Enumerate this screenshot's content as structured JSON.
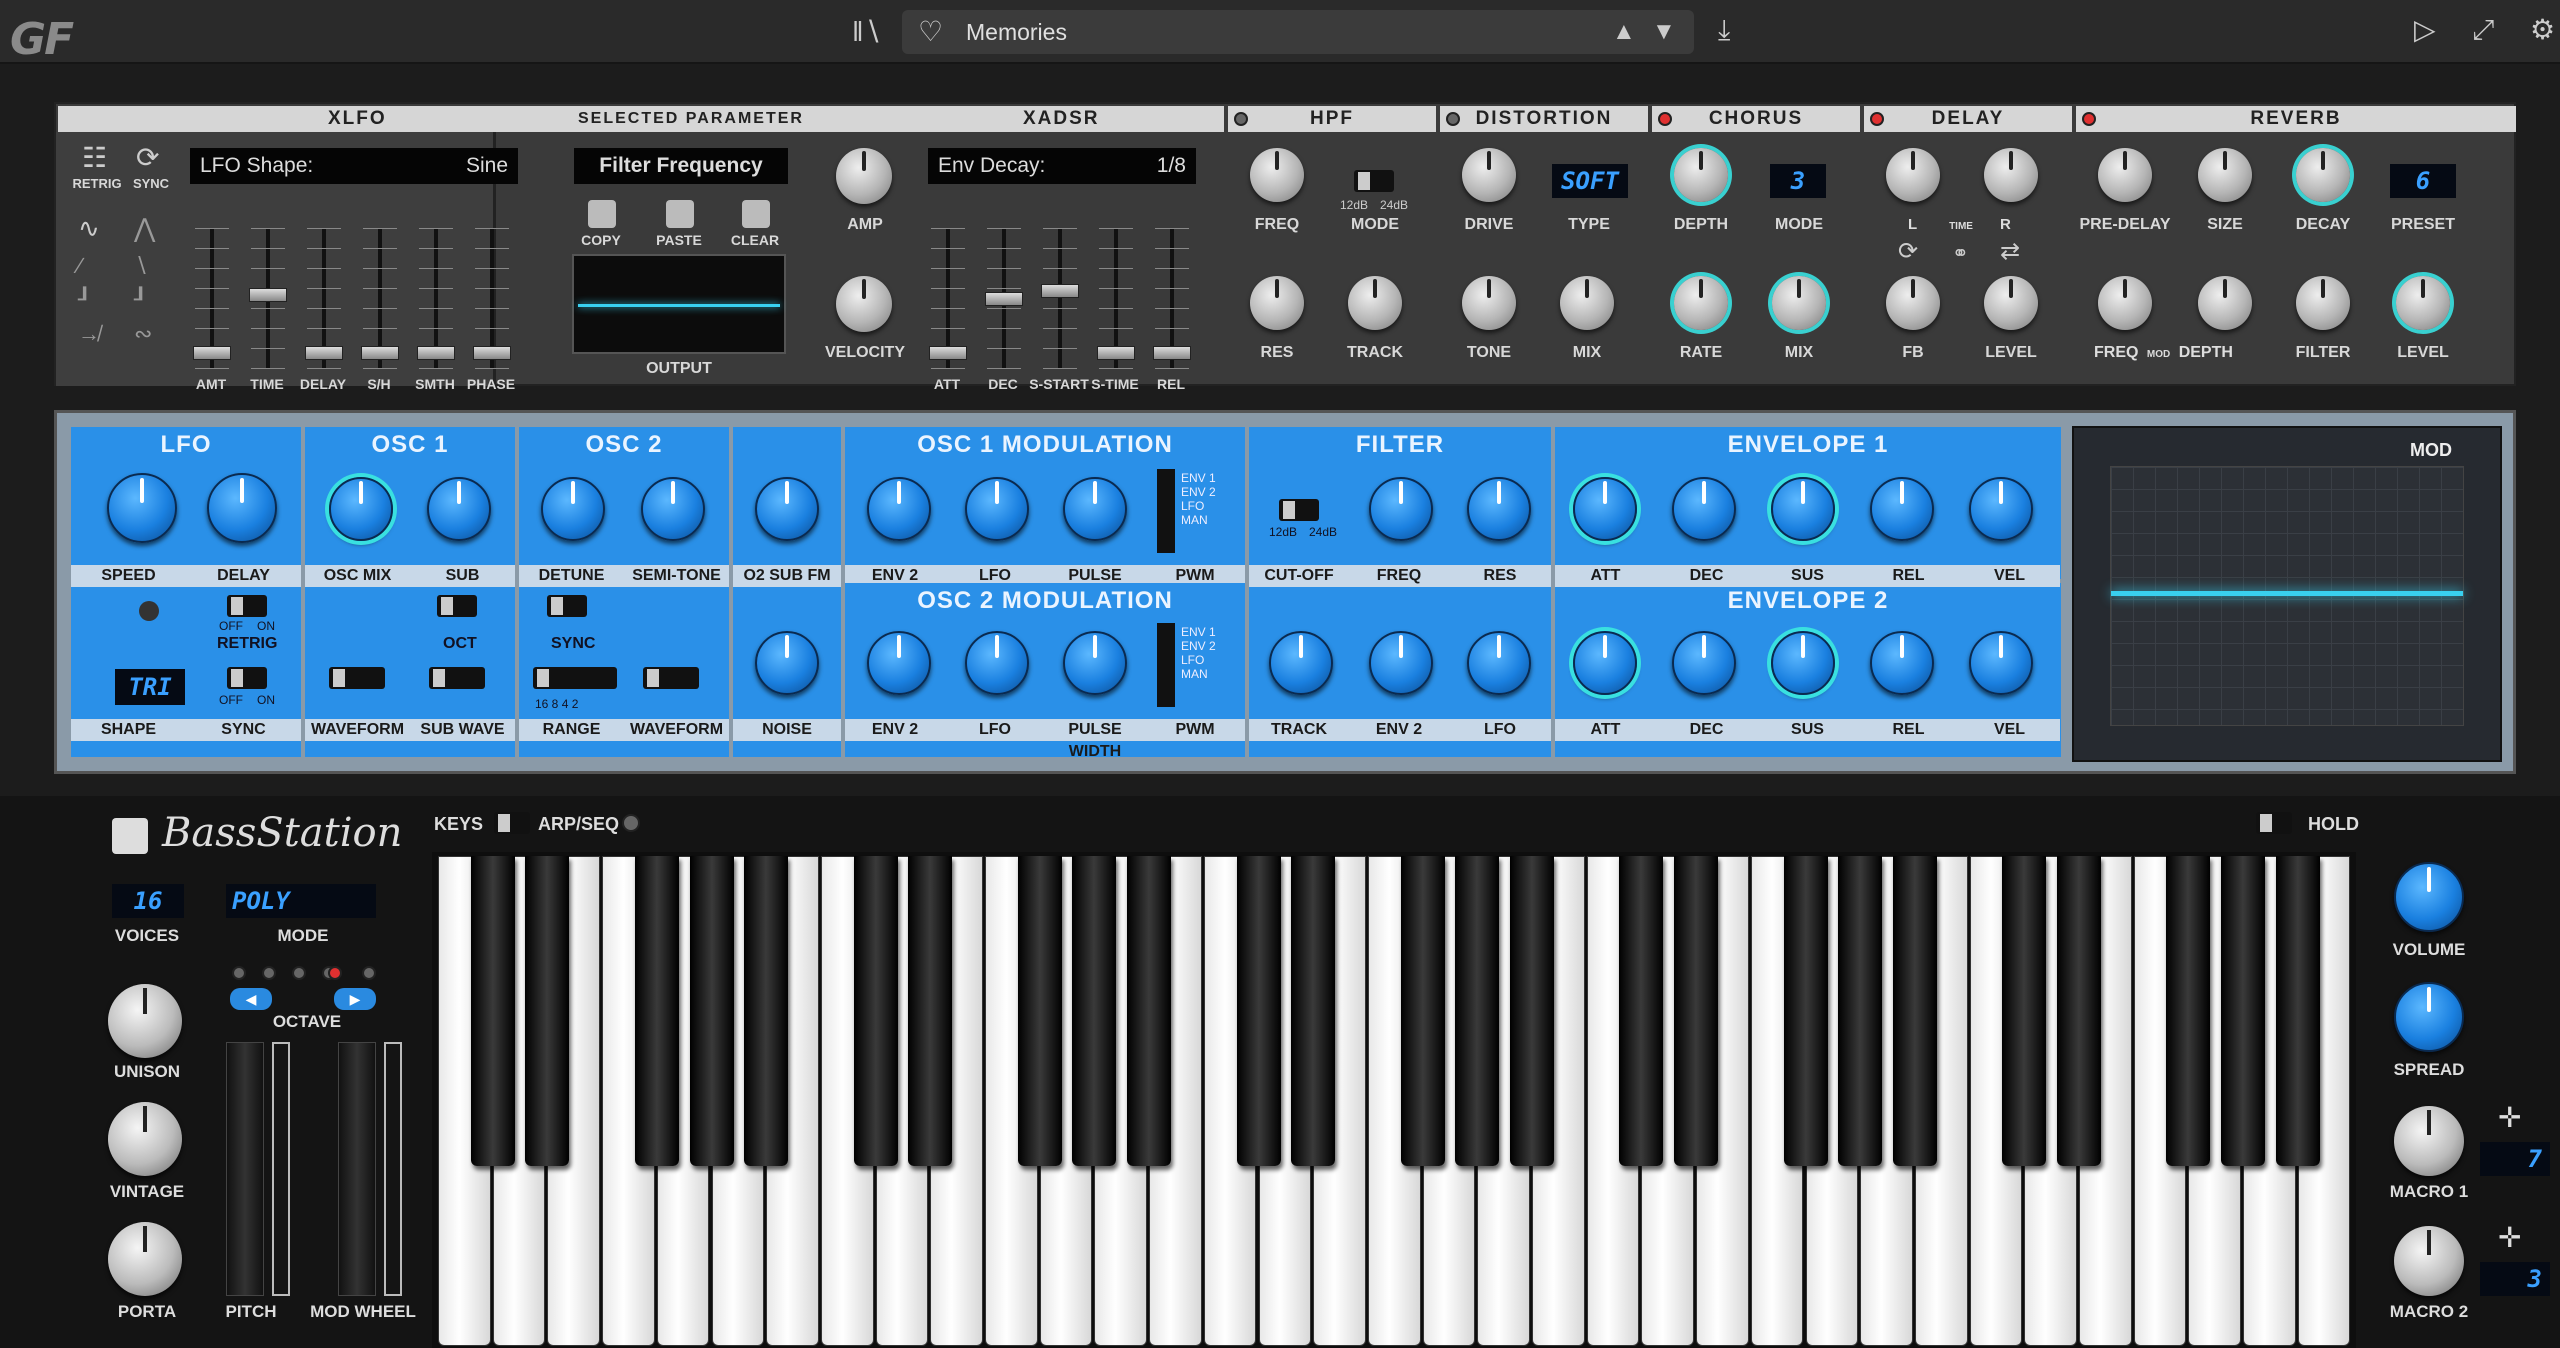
{
  "app": {
    "logo": "GF",
    "preset_name": "Memories"
  },
  "fx": {
    "headers": {
      "xlfo": "XLFO",
      "selected": "SELECTED PARAMETER",
      "xadsr": "XADSR",
      "hpf": "HPF",
      "distortion": "DISTORTION",
      "chorus": "CHORUS",
      "delay": "DELAY",
      "reverb": "REVERB"
    },
    "xlfo": {
      "retrig": "RETRIG",
      "sync": "SYNC",
      "shape_label": "LFO Shape:",
      "shape_value": "Sine",
      "faders": [
        "AMT",
        "TIME",
        "DELAY",
        "S/H",
        "SMTH",
        "PHASE"
      ]
    },
    "selected": {
      "param": "Filter Frequency",
      "copy": "COPY",
      "paste": "PASTE",
      "clear": "CLEAR",
      "output": "OUTPUT"
    },
    "xadsr": {
      "amp": "AMP",
      "velocity": "VELOCITY",
      "env_label": "Env Decay:",
      "env_value": "1/8",
      "faders": [
        "ATT",
        "DEC",
        "S-START",
        "S-TIME",
        "REL"
      ]
    },
    "hpf": {
      "freq": "FREQ",
      "mode": "MODE",
      "m1": "12dB",
      "m2": "24dB",
      "res": "RES",
      "track": "TRACK"
    },
    "dist": {
      "drive": "DRIVE",
      "type": "TYPE",
      "type_value": "SOFT",
      "tone": "TONE",
      "mix": "MIX"
    },
    "chorus": {
      "depth": "DEPTH",
      "mode": "MODE",
      "mode_value": "3",
      "rate": "RATE",
      "mix": "MIX"
    },
    "delay": {
      "l": "L",
      "time": "TIME",
      "r": "R",
      "fb": "FB",
      "level": "LEVEL"
    },
    "reverb": {
      "predelay": "PRE-DELAY",
      "size": "SIZE",
      "decay": "DECAY",
      "preset": "PRESET",
      "preset_value": "6",
      "freq": "FREQ",
      "mod": "MOD",
      "depth": "DEPTH",
      "filter": "FILTER",
      "level": "LEVEL"
    }
  },
  "bs": {
    "lfo": {
      "title": "LFO",
      "speed": "SPEED",
      "delay": "DELAY",
      "retrig": "RETRIG",
      "off": "OFF",
      "on": "ON",
      "shape": "SHAPE",
      "shape_value": "TRI",
      "sync": "SYNC"
    },
    "osc1": {
      "title": "OSC 1",
      "oscmix": "OSC MIX",
      "sub": "SUB",
      "oct": "OCT",
      "waveform": "WAVEFORM",
      "subwave": "SUB WAVE"
    },
    "osc2": {
      "title": "OSC 2",
      "detune": "DETUNE",
      "semitone": "SEMI-TONE",
      "sync": "SYNC",
      "range": "RANGE",
      "range_marks": "16  8  4  2",
      "waveform": "WAVEFORM"
    },
    "o2": {
      "subfm": "O2 SUB FM",
      "noise": "NOISE"
    },
    "osc1mod": {
      "title": "OSC 1 MODULATION",
      "env2": "ENV 2",
      "lfo": "LFO",
      "pw": "PULSE WIDTH",
      "pwm": "PWM",
      "opts": [
        "ENV 1",
        "ENV 2",
        "LFO",
        "MAN"
      ]
    },
    "osc2mod": {
      "title": "OSC 2 MODULATION",
      "env2": "ENV 2",
      "lfo": "LFO",
      "pw": "PULSE WIDTH",
      "pwm": "PWM",
      "opts": [
        "ENV 1",
        "ENV 2",
        "LFO",
        "MAN"
      ]
    },
    "filter": {
      "title": "FILTER",
      "cutoff": "CUT-OFF",
      "m1": "12dB",
      "m2": "24dB",
      "freq": "FREQ",
      "res": "RES",
      "track": "TRACK",
      "env2": "ENV 2",
      "lfo": "LFO"
    },
    "env1": {
      "title": "ENVELOPE 1",
      "labels": [
        "ATT",
        "DEC",
        "SUS",
        "REL",
        "VEL"
      ]
    },
    "env2": {
      "title": "ENVELOPE 2",
      "labels": [
        "ATT",
        "DEC",
        "SUS",
        "REL",
        "VEL"
      ]
    },
    "mod": "MOD"
  },
  "perf": {
    "brand": "BassStation",
    "keys": "KEYS",
    "arp": "ARP/SEQ",
    "hold": "HOLD",
    "voices": "VOICES",
    "voices_value": "16",
    "mode": "MODE",
    "mode_value": "POLY",
    "octave": "OCTAVE",
    "unison": "UNISON",
    "vintage": "VINTAGE",
    "porta": "PORTA",
    "pitch": "PITCH",
    "modwheel": "MOD WHEEL",
    "volume": "VOLUME",
    "spread": "SPREAD",
    "macro1": "MACRO 1",
    "macro1_value": "7",
    "macro2": "MACRO 2",
    "macro2_value": "3"
  }
}
